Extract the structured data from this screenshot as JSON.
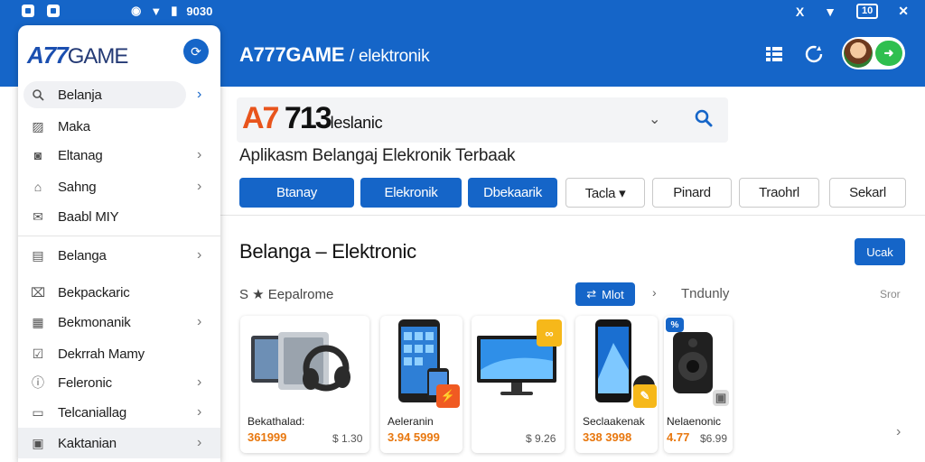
{
  "status_bar": {
    "left_time": "9030",
    "right_battery": "10",
    "close_glyph": "X"
  },
  "header": {
    "title": "A777GAME",
    "breadcrumb": "/ elektronik",
    "colors": {
      "primary": "#1565c8",
      "accent": "#e8770e"
    }
  },
  "drawer": {
    "logo_mark": "A77",
    "logo_rest": "GAME",
    "items": [
      {
        "label": "Belanja",
        "icon": "search-icon",
        "chevron": true,
        "active_search": true
      },
      {
        "label": "Maka",
        "icon": "image-icon",
        "chevron": false
      },
      {
        "label": "Eltanag",
        "icon": "camera-icon",
        "chevron": true
      },
      {
        "label": "Sahng",
        "icon": "bag-icon",
        "chevron": true
      },
      {
        "label": "Baabl MIY",
        "icon": "mail-icon",
        "chevron": false
      },
      {
        "label": "Belanga",
        "icon": "grid-icon",
        "chevron": true
      },
      {
        "label": "Bekpackaric",
        "icon": "lock-icon",
        "chevron": false
      },
      {
        "label": "Bekmonanik",
        "icon": "tv-icon",
        "chevron": true
      },
      {
        "label": "Dekrrah Mamy",
        "icon": "check-icon",
        "chevron": false
      },
      {
        "label": "Feleronic",
        "icon": "info-icon",
        "chevron": true
      },
      {
        "label": "Telcaniallag",
        "icon": "doc-icon",
        "chevron": true
      },
      {
        "label": "Kaktanian",
        "icon": "card-icon",
        "chevron": true,
        "active": true
      }
    ]
  },
  "search": {
    "logo_accent": "A7",
    "logo_main": " 713",
    "logo_suffix": "leslanic"
  },
  "subtitle": "Aplikasm Belangaj Elekronik Terbaak",
  "chips": [
    {
      "label": "Btanay",
      "filled": true
    },
    {
      "label": "Elekronik",
      "filled": true
    },
    {
      "label": "Dbekaarik",
      "filled": true
    },
    {
      "label": "Tacla ▾",
      "filled": false
    },
    {
      "label": "Pinard",
      "filled": false
    },
    {
      "label": "Traohrl",
      "filled": false
    },
    {
      "label": "Sekarl",
      "filled": false
    }
  ],
  "section": {
    "title": "Belanga – Elektronic",
    "action_label": "Ucak"
  },
  "filters": {
    "label": "S ★ Eepalrome",
    "pill_label": "Mlot",
    "sort_label": "Tndunly",
    "end_label": "Sror"
  },
  "products": [
    {
      "name": "Bekathalad:",
      "price": "361999",
      "old_price": "$ 1.30",
      "image": "speaker-headphones"
    },
    {
      "name": "Aeleranin",
      "price": "3.94 5999",
      "old_price": "",
      "image": "smartphone"
    },
    {
      "name": "",
      "price": "",
      "old_price": "$ 9.26",
      "image": "monitor"
    },
    {
      "name": "Seclaakenak",
      "price": "338 3998",
      "old_price": "",
      "image": "smartphone-blue"
    },
    {
      "name": "Nelaenonic",
      "price": "4.77",
      "old_price": "$6.99",
      "image": "speaker"
    }
  ]
}
